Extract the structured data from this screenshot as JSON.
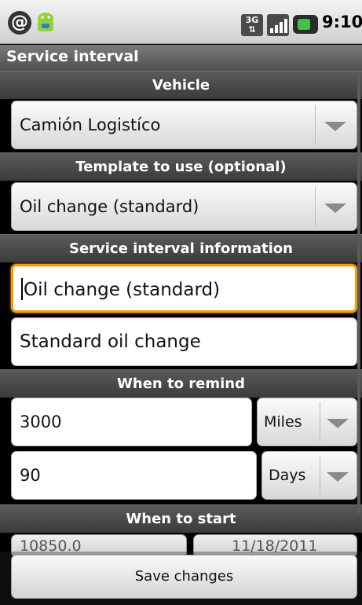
{
  "status_bar": {
    "network_label": "3G",
    "time": "9:10",
    "icons": [
      "at-sign-icon",
      "android-icon",
      "network-3g-icon",
      "signal-icon",
      "battery-icon"
    ]
  },
  "title_bar": {
    "title": "Service interval"
  },
  "sections": {
    "vehicle": "Vehicle",
    "template": "Template to use (optional)",
    "info": "Service interval information",
    "remind": "When to remind",
    "start": "When to start"
  },
  "vehicle_spinner": {
    "value": "Camión Logistíco"
  },
  "template_spinner": {
    "value": "Oil change (standard)"
  },
  "name_field": {
    "value": "Oil change (standard)"
  },
  "description_field": {
    "value": "Standard oil change"
  },
  "remind": {
    "distance_value": "3000",
    "distance_unit": "Miles",
    "time_value": "90",
    "time_unit": "Days"
  },
  "start": {
    "odometer_value": "10850.0",
    "date_value": "11/18/2011"
  },
  "save_button": {
    "label": "Save changes"
  },
  "colors": {
    "focus": "#ff9a00",
    "header_bg": "#4a4a4a",
    "battery": "#45c04d"
  }
}
